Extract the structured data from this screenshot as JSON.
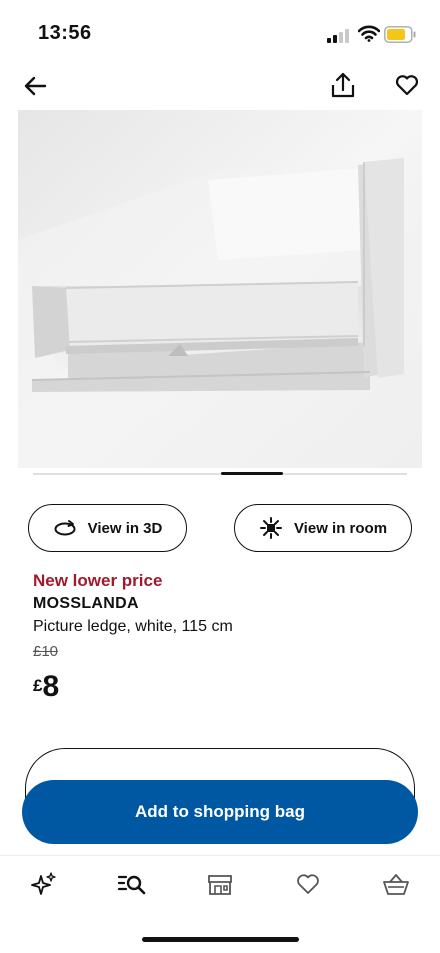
{
  "status_bar": {
    "time": "13:56"
  },
  "product": {
    "actions": {
      "view_3d": "View in 3D",
      "view_room": "View in room"
    },
    "price_tag": "New lower price",
    "name": "MOSSLANDA",
    "description": "Picture ledge, white, 115 cm",
    "old_price": "£10",
    "currency": "£",
    "price": "8"
  },
  "cart": {
    "add_label": "Add to shopping bag"
  },
  "colors": {
    "accent": "#0058a3",
    "price_tag": "#a11a2b",
    "battery": "#f5c518"
  },
  "icons": [
    "back-arrow-icon",
    "share-icon",
    "heart-icon",
    "rotate-3d-icon",
    "view-in-room-icon",
    "sparkle-icon",
    "search-list-icon",
    "store-icon",
    "heart-icon",
    "basket-icon"
  ]
}
